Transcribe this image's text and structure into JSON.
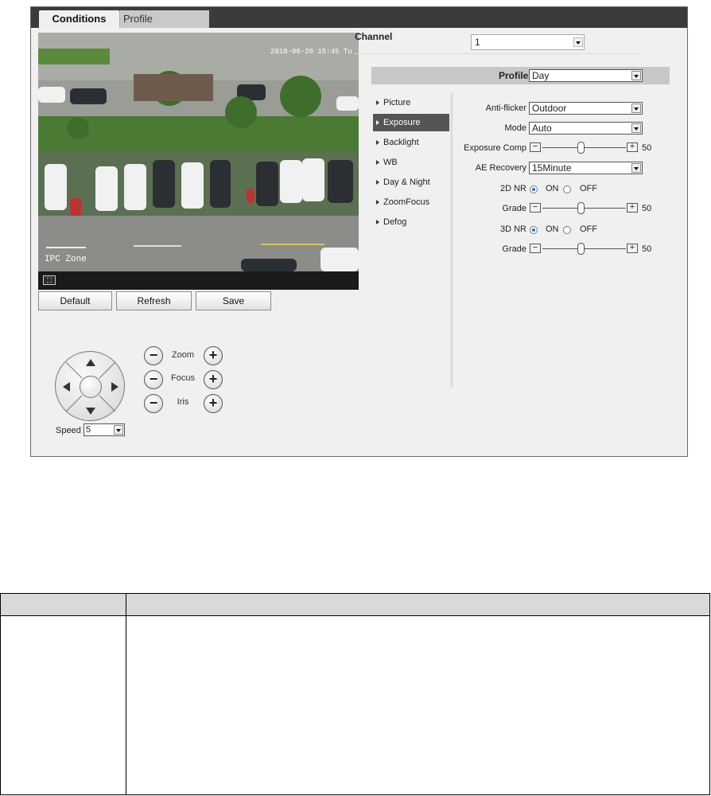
{
  "tabs": [
    {
      "label": "Conditions",
      "active": true
    },
    {
      "label": "Profile Management",
      "active": false
    }
  ],
  "video": {
    "osd_text": "IPC Zone",
    "timestamp": "2018-06-26 15:45 Tu"
  },
  "actions": {
    "default_label": "Default",
    "refresh_label": "Refresh",
    "save_label": "Save"
  },
  "ptz": {
    "zoom_label": "Zoom",
    "focus_label": "Focus",
    "iris_label": "Iris",
    "speed_label": "Speed",
    "speed_value": "5",
    "minus_glyph": "−",
    "plus_glyph": "+"
  },
  "channel": {
    "label": "Channel",
    "value": "1"
  },
  "profile": {
    "label": "Profile",
    "value": "Day"
  },
  "menu": {
    "items": [
      "Picture",
      "Exposure",
      "Backlight",
      "WB",
      "Day & Night",
      "ZoomFocus",
      "Defog"
    ],
    "active": "Exposure"
  },
  "exposure": {
    "anti_flicker_label": "Anti-flicker",
    "anti_flicker_value": "Outdoor",
    "mode_label": "Mode",
    "mode_value": "Auto",
    "exposure_comp_label": "Exposure Comp",
    "exposure_comp_value": "50",
    "ae_recovery_label": "AE Recovery",
    "ae_recovery_value": "15Minute",
    "nr2d_label": "2D NR",
    "nr2d_on": "ON",
    "nr2d_off": "OFF",
    "nr2d_selected": "ON",
    "grade1_label": "Grade",
    "grade1_value": "50",
    "nr3d_label": "3D NR",
    "nr3d_on": "ON",
    "nr3d_off": "OFF",
    "nr3d_selected": "ON",
    "grade2_label": "Grade",
    "grade2_value": "50",
    "slider_minus": "−",
    "slider_plus": "+"
  },
  "colors": {
    "tabbar": "#3b3b3b",
    "active_menu": "#555555",
    "radio_selected": "#2a6fc9"
  }
}
